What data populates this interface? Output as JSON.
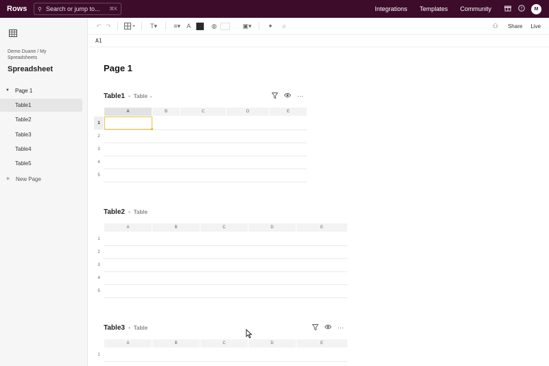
{
  "topbar": {
    "logo": "Rows",
    "search_placeholder": "Search or jump to...",
    "search_shortcut": "⌘K",
    "links": [
      "Integrations",
      "Templates",
      "Community"
    ],
    "avatar_initial": "M",
    "bg_color": "#3d0c2b"
  },
  "sidebar": {
    "breadcrumb": "Demo Duane / My Spreadsheets",
    "title": "Spreadsheet",
    "page": "Page 1",
    "tables": [
      "Table1",
      "Table2",
      "Table3",
      "Table4",
      "Table5"
    ],
    "active_table": "Table1",
    "new_page": "New Page"
  },
  "toolbar": {
    "share": "Share",
    "live": "Live"
  },
  "formula": {
    "cell_ref": "A1"
  },
  "main": {
    "page_title": "Page 1",
    "tables": [
      {
        "name": "Table1",
        "type": "Table",
        "has_dropdown": true,
        "has_actions": true,
        "columns": [
          "A",
          "B",
          "C",
          "D",
          "E"
        ],
        "rows": [
          "1",
          "2",
          "3",
          "4",
          "5"
        ],
        "selected_cell": "A1"
      },
      {
        "name": "Table2",
        "type": "Table",
        "has_dropdown": false,
        "has_actions": false,
        "columns": [
          "A",
          "B",
          "C",
          "D",
          "E"
        ],
        "rows": [
          "1",
          "2",
          "3",
          "4",
          "5"
        ]
      },
      {
        "name": "Table3",
        "type": "Table",
        "has_dropdown": false,
        "has_actions": true,
        "columns": [
          "A",
          "B",
          "C",
          "D",
          "E"
        ],
        "rows": [
          "1"
        ]
      }
    ]
  },
  "colors": {
    "selection": "#e8c33e",
    "sidebar_bg": "#f6f6f6"
  }
}
